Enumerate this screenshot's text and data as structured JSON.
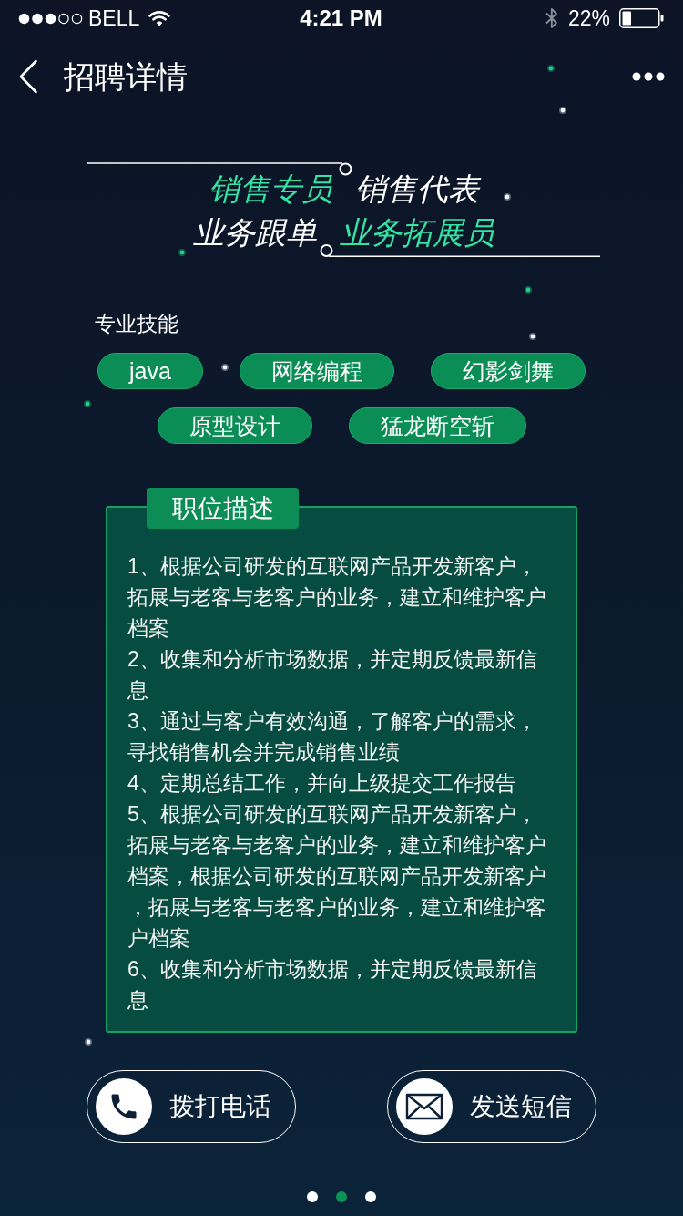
{
  "status_bar": {
    "carrier": "BELL",
    "time": "4:21 PM",
    "battery": "22%"
  },
  "nav": {
    "title": "招聘详情"
  },
  "position_rows": [
    {
      "items": [
        {
          "label": "销售专员",
          "highlighted": true
        },
        {
          "label": "销售代表",
          "highlighted": false
        }
      ]
    },
    {
      "items": [
        {
          "label": "业务跟单",
          "highlighted": false
        },
        {
          "label": "业务拓展员",
          "highlighted": true
        }
      ]
    }
  ],
  "skills": {
    "label": "专业技能",
    "tags": [
      "java",
      "网络编程",
      "幻影剑舞",
      "原型设计",
      "猛龙断空斩"
    ]
  },
  "description": {
    "title": "职位描述",
    "items": [
      "1、根据公司研发的互联网产品开发新客户，拓展与老客与老客户的业务，建立和维护客户档案",
      "2、收集和分析市场数据，并定期反馈最新信息",
      "3、通过与客户有效沟通，了解客户的需求，寻找销售机会并完成销售业绩",
      "4、定期总结工作，并向上级提交工作报告",
      "5、根据公司研发的互联网产品开发新客户，拓展与老客与老客户的业务，建立和维护客户档案，根据公司研发的互联网产品开发新客户，拓展与老客与老客户的业务，建立和维护客户档案",
      "6、收集和分析市场数据，并定期反馈最新信息"
    ]
  },
  "actions": [
    {
      "kind": "phone",
      "label": "拨打电话"
    },
    {
      "kind": "message",
      "label": "发送短信"
    }
  ],
  "pager": [
    {
      "selected": false
    },
    {
      "selected": true
    },
    {
      "selected": false
    }
  ]
}
